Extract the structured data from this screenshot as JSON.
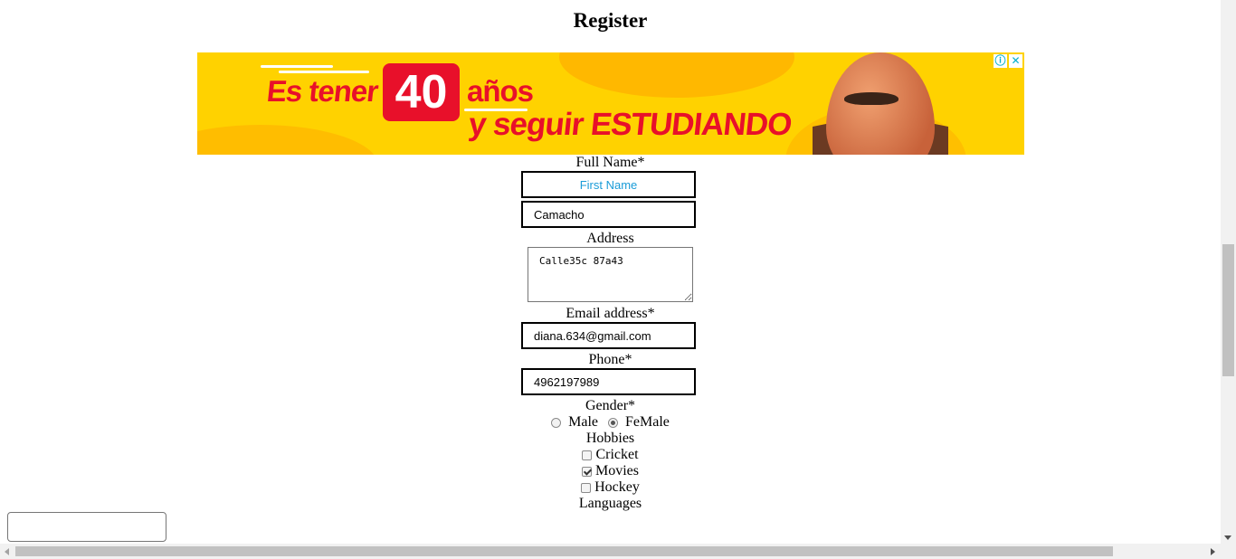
{
  "page": {
    "title": "Register"
  },
  "ad": {
    "line1_a": "Es tener",
    "number": "40",
    "line1_b": "años",
    "line2_a": "y seguir",
    "line2_b": "ESTUDIANDO",
    "info_icon": "ⓘ",
    "close_icon": "✕"
  },
  "form": {
    "full_name_label": "Full Name*",
    "first_name_placeholder": "First Name",
    "first_name_value": "",
    "last_name_value": "Camacho",
    "address_label": "Address",
    "address_value": "Calle35c 87a43",
    "email_label": "Email address*",
    "email_value": "diana.634@gmail.com",
    "phone_label": "Phone*",
    "phone_value": "4962197989",
    "gender_label": "Gender*",
    "gender_options": [
      "Male",
      "FeMale"
    ],
    "gender_selected": "FeMale",
    "hobbies_label": "Hobbies",
    "hobbies": [
      {
        "label": "Cricket",
        "checked": false
      },
      {
        "label": "Movies",
        "checked": true
      },
      {
        "label": "Hockey",
        "checked": false
      }
    ],
    "languages_label": "Languages"
  }
}
